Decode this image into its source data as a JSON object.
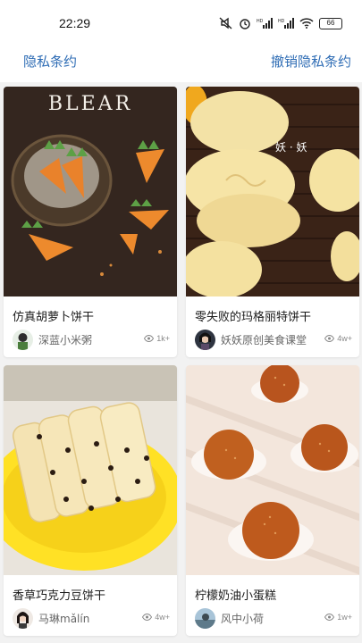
{
  "status_bar": {
    "time": "22:29",
    "battery": "66"
  },
  "nav": {
    "privacy": "隐私条约",
    "revoke_privacy": "撤销隐私条约"
  },
  "cards": [
    {
      "title": "仿真胡萝卜饼干",
      "author": "深蓝小米粥",
      "views": "1k+",
      "image_text": "BLEAR"
    },
    {
      "title": "零失败的玛格丽特饼干",
      "author": "妖妖原创美食课堂",
      "views": "4w+",
      "image_text": "妖 · 妖"
    },
    {
      "title": "香草巧克力豆饼干",
      "author": "马琳mǎlín",
      "views": "4w+"
    },
    {
      "title": "柠檬奶油小蛋糕",
      "author": "风中小荷",
      "views": "1w+"
    }
  ]
}
